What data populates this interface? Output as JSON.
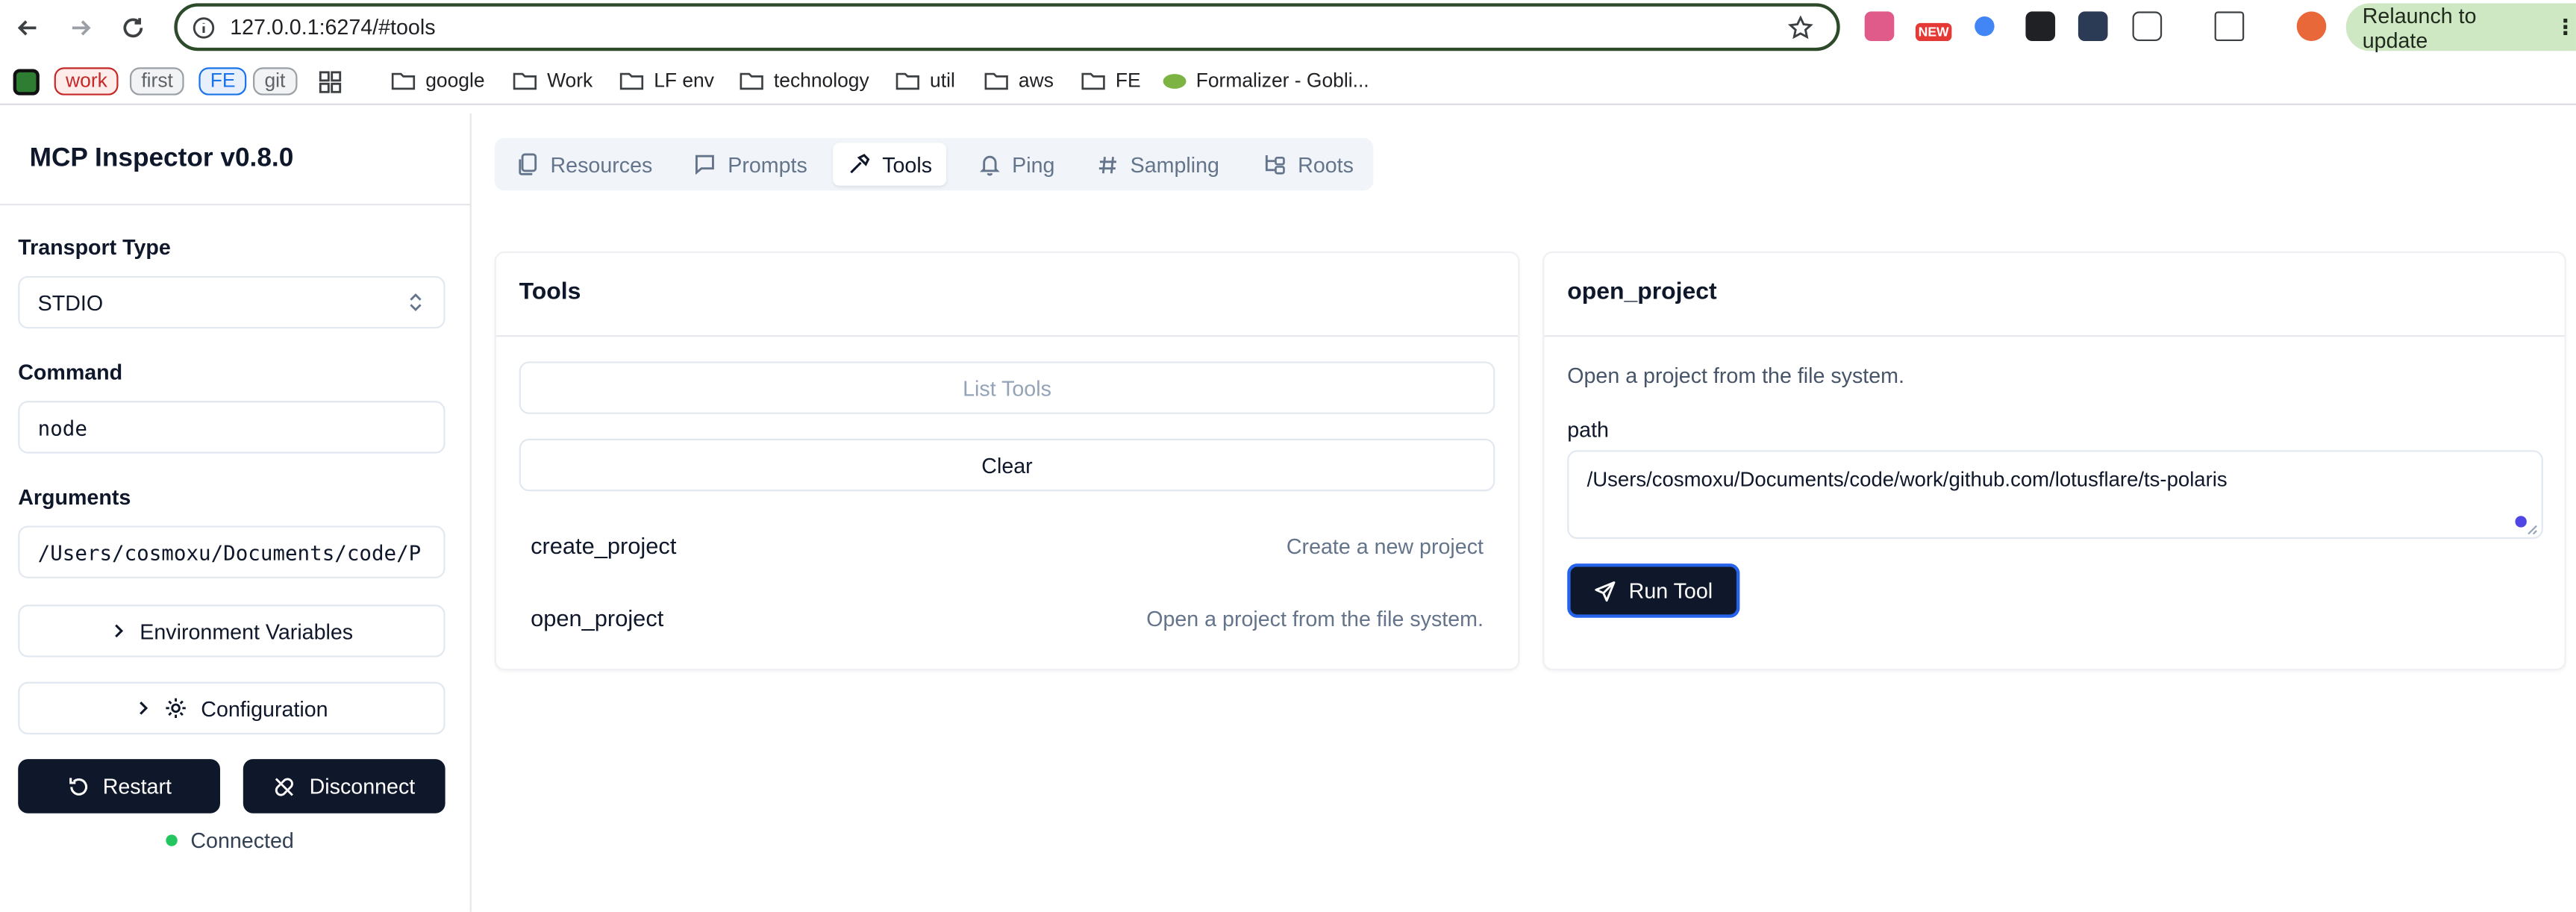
{
  "browser": {
    "url": "127.0.0.1:6274/#tools",
    "relaunch_label": "Relaunch to update",
    "new_badge": "NEW",
    "tag_pills": [
      "work",
      "first",
      "FE",
      "git"
    ],
    "bookmarks": [
      "google",
      "Work",
      "LF env",
      "technology",
      "util",
      "aws",
      "FE",
      "Formalizer - Gobli..."
    ]
  },
  "sidebar": {
    "title": "MCP Inspector v0.8.0",
    "transport_label": "Transport Type",
    "transport_value": "STDIO",
    "command_label": "Command",
    "command_value": "node",
    "arguments_label": "Arguments",
    "arguments_value": "/Users/cosmoxu/Documents/code/P",
    "env_label": "Environment Variables",
    "config_label": "Configuration",
    "restart_label": "Restart",
    "disconnect_label": "Disconnect",
    "status_label": "Connected"
  },
  "tabs": [
    "Resources",
    "Prompts",
    "Tools",
    "Ping",
    "Sampling",
    "Roots"
  ],
  "active_tab": "Tools",
  "tools_panel": {
    "title": "Tools",
    "list_label": "List Tools",
    "clear_label": "Clear",
    "items": [
      {
        "name": "create_project",
        "description": "Create a new project"
      },
      {
        "name": "open_project",
        "description": "Open a project from the file system."
      }
    ]
  },
  "detail_panel": {
    "title": "open_project",
    "description": "Open a project from the file system.",
    "param_label": "path",
    "param_value": "/Users/cosmoxu/Documents/code/work/github.com/lotusflare/ts-polaris",
    "run_label": "Run Tool"
  },
  "colors": {
    "accent_dark": "#0f172a",
    "status_green": "#22c55e",
    "focus_blue": "#2563eb"
  }
}
